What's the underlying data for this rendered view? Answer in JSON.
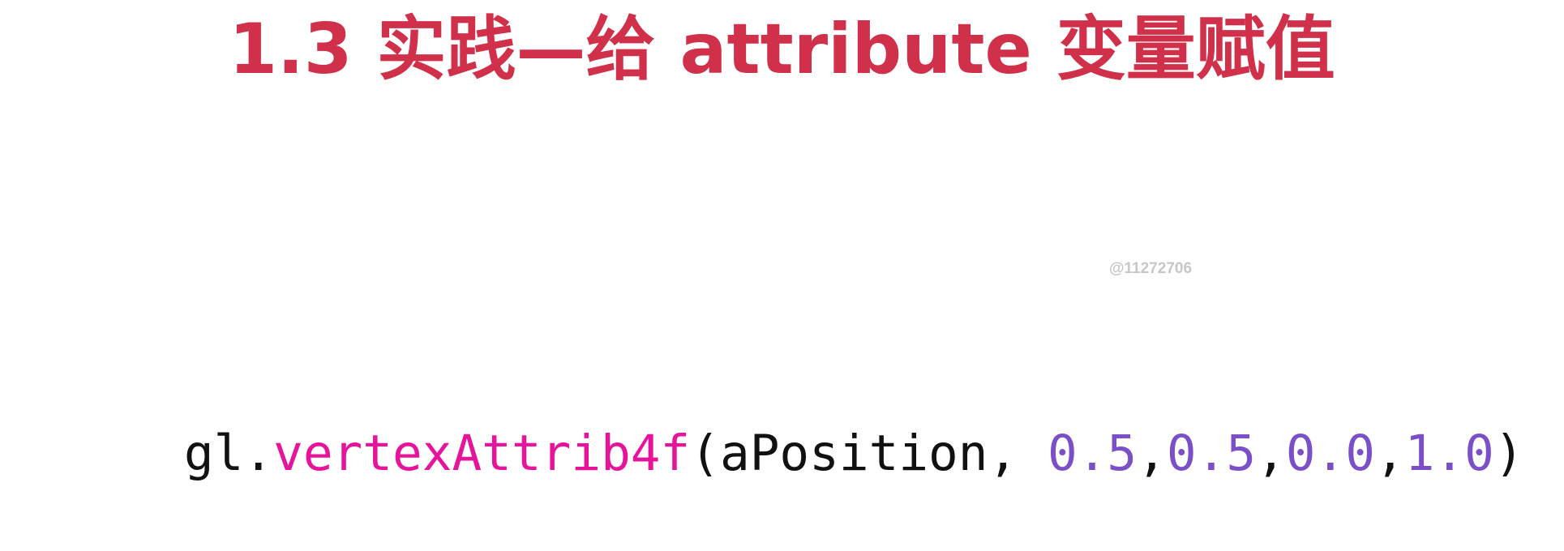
{
  "slide": {
    "title": "1.3 实践—给 attribute 变量赋值",
    "watermark": "@11272706"
  },
  "code_line": {
    "tokens": [
      {
        "text": "gl.",
        "role": "object"
      },
      {
        "text": "vertexAttrib4f",
        "role": "method"
      },
      {
        "text": "(aPosition, ",
        "role": "plain"
      },
      {
        "text": "0.5",
        "role": "number"
      },
      {
        "text": ",",
        "role": "plain"
      },
      {
        "text": "0.5",
        "role": "number"
      },
      {
        "text": ",",
        "role": "plain"
      },
      {
        "text": "0.0",
        "role": "number"
      },
      {
        "text": ",",
        "role": "plain"
      },
      {
        "text": "1.0",
        "role": "number"
      },
      {
        "text": ")",
        "role": "plain"
      }
    ]
  },
  "colors": {
    "title": "#d0304a",
    "code_plain": "#111111",
    "code_method": "#e6149a",
    "code_number": "#7b4fc8",
    "watermark": "#c7c7c7"
  }
}
